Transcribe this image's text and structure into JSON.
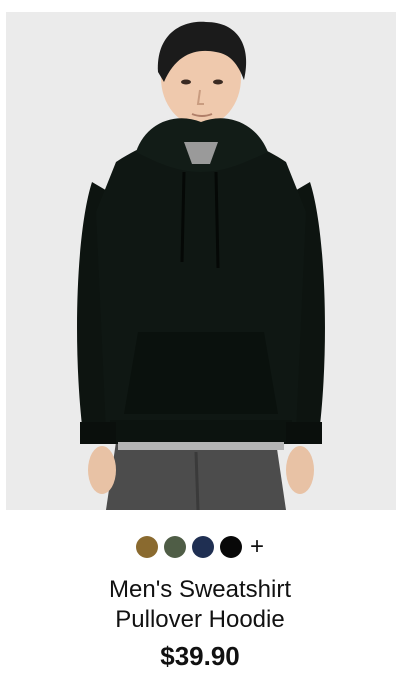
{
  "product": {
    "image_alt": "Model wearing black pullover hoodie",
    "title_line1": "Men's Sweatshirt",
    "title_line2": "Pullover Hoodie",
    "price": "$39.90",
    "more_colors_label": "+",
    "swatches": [
      {
        "name": "brown",
        "color": "#8a6a2f"
      },
      {
        "name": "olive",
        "color": "#4f5d46"
      },
      {
        "name": "navy",
        "color": "#1f2f52"
      },
      {
        "name": "black",
        "color": "#080808"
      }
    ]
  }
}
